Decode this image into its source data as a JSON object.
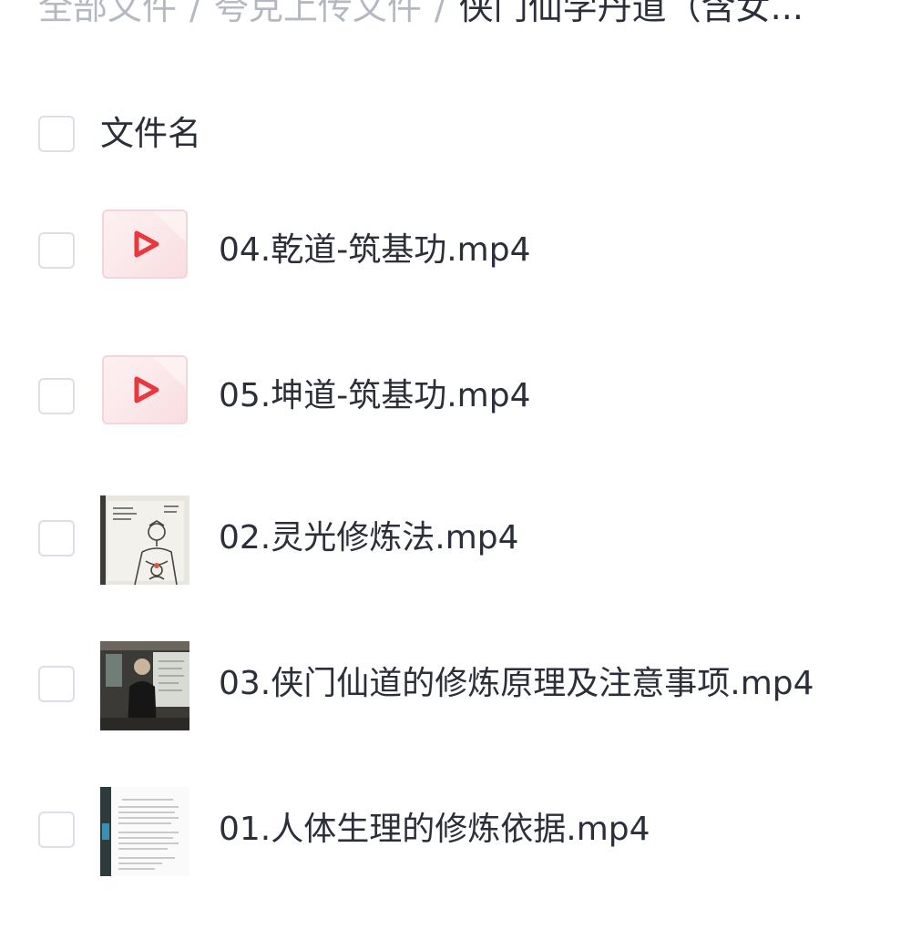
{
  "breadcrumb": {
    "items": [
      "全部文件",
      "夸克上传文件"
    ],
    "separator": "/",
    "current": "侠门仙学丹道（含女..."
  },
  "list_header": {
    "name_column": "文件名"
  },
  "files": [
    {
      "name": "04.乾道-筑基功.mp4",
      "thumbnail": "video-play-icon"
    },
    {
      "name": "05.坤道-筑基功.mp4",
      "thumbnail": "video-play-icon"
    },
    {
      "name": "02.灵光修炼法.mp4",
      "thumbnail": "sketch-figure-thumbnail"
    },
    {
      "name": "03.侠门仙道的修炼原理及注意事项.mp4",
      "thumbnail": "lecturer-thumbnail"
    },
    {
      "name": "01.人体生理的修炼依据.mp4",
      "thumbnail": "document-slide-thumbnail"
    }
  ],
  "colors": {
    "text": "#2b2f3a",
    "muted": "#b4b8c0",
    "checkbox_border": "#dcdfe6",
    "play_icon": "#e8383d"
  }
}
